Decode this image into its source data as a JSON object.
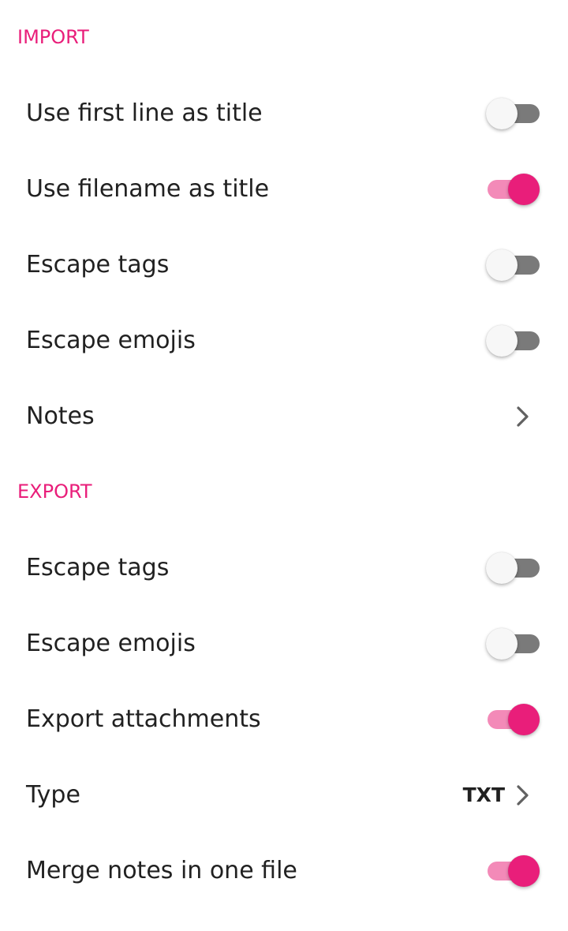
{
  "import": {
    "header": "IMPORT",
    "items": [
      {
        "label": "Use first line as title",
        "type": "toggle",
        "checked": false
      },
      {
        "label": "Use filename as title",
        "type": "toggle",
        "checked": true
      },
      {
        "label": "Escape tags",
        "type": "toggle",
        "checked": false
      },
      {
        "label": "Escape emojis",
        "type": "toggle",
        "checked": false
      },
      {
        "label": "Notes",
        "type": "link",
        "icon": "chevron-right-icon"
      }
    ]
  },
  "export": {
    "header": "EXPORT",
    "items": [
      {
        "label": "Escape tags",
        "type": "toggle",
        "checked": false
      },
      {
        "label": "Escape emojis",
        "type": "toggle",
        "checked": false
      },
      {
        "label": "Export attachments",
        "type": "toggle",
        "checked": true
      },
      {
        "label": "Type",
        "type": "link",
        "value": "TXT",
        "icon": "chevron-right-icon"
      },
      {
        "label": "Merge notes in one file",
        "type": "toggle",
        "checked": true
      }
    ]
  },
  "colors": {
    "accent": "#e91e7a",
    "accent_track": "#f38ab8",
    "off_track": "#7a7a7a",
    "off_thumb": "#f7f7f7",
    "text": "#212121"
  }
}
